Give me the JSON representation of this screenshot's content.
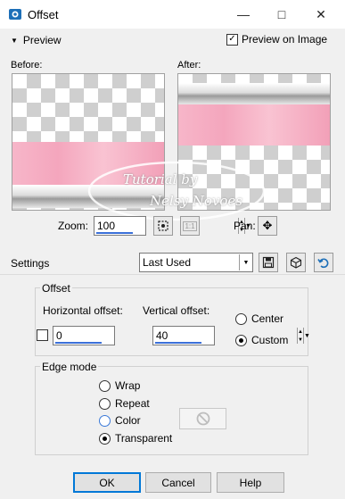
{
  "window": {
    "title": "Offset",
    "minimize_glyph": "—",
    "maximize_glyph": "□",
    "close_glyph": "✕"
  },
  "preview_section": {
    "toggle_label": "Preview",
    "preview_on_image_label": "Preview on Image",
    "preview_on_image_checked": true
  },
  "before": {
    "label": "Before:"
  },
  "after": {
    "label": "After:"
  },
  "watermark": {
    "line1": "Tutorial by",
    "line2": "Nelsy Novoes"
  },
  "zoom": {
    "label": "Zoom:",
    "value": "100"
  },
  "pan": {
    "label": "Pan:"
  },
  "settings": {
    "label": "Settings",
    "preset_value": "Last Used"
  },
  "offset_group": {
    "title": "Offset",
    "horizontal_label": "Horizontal offset:",
    "horizontal_value": "0",
    "vertical_label": "Vertical offset:",
    "vertical_value": "40",
    "center_label": "Center",
    "custom_label": "Custom",
    "selected": "Custom"
  },
  "edge_mode": {
    "title": "Edge mode",
    "options": [
      "Wrap",
      "Repeat",
      "Color",
      "Transparent"
    ],
    "selected": "Transparent"
  },
  "buttons": {
    "ok": "OK",
    "cancel": "Cancel",
    "help": "Help"
  },
  "colors": {
    "pink": "#f4a6bd",
    "accent_blue": "#0078d7",
    "checker": "#cfcfcf"
  }
}
